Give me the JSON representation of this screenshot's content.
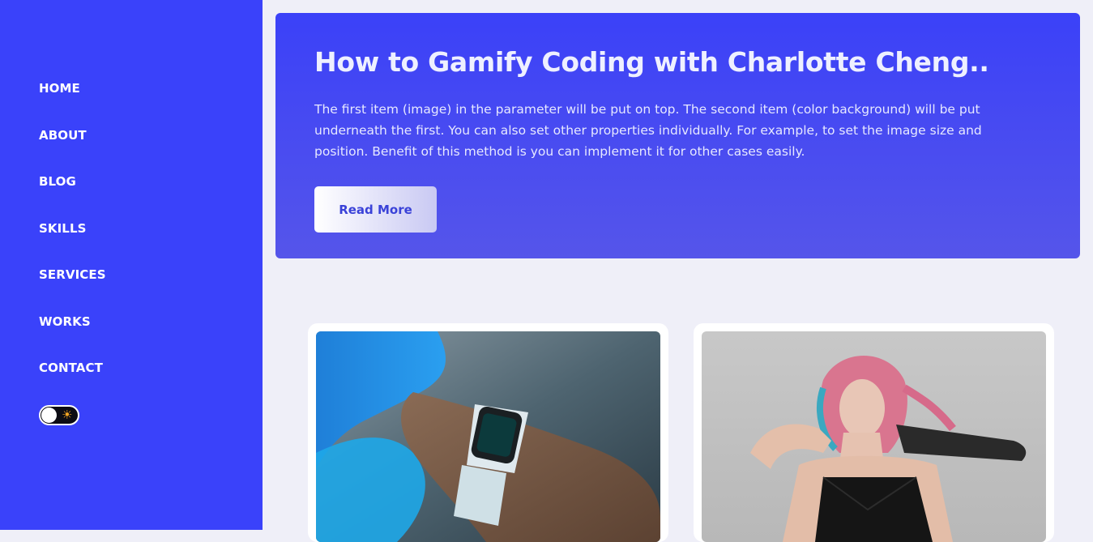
{
  "nav": {
    "items": [
      {
        "label": "HOME"
      },
      {
        "label": "ABOUT"
      },
      {
        "label": "BLOG"
      },
      {
        "label": "SKILLS"
      },
      {
        "label": "SERVICES"
      },
      {
        "label": "WORKS"
      },
      {
        "label": "CONTACT"
      }
    ],
    "theme_icon": "sun-icon"
  },
  "hero": {
    "title": "How to Gamify Coding with Charlotte Cheng..",
    "description": "The first item (image) in the parameter will be put on top. The second item (color background) will be put underneath the first. You can also set other properties individually. For example, to set the image size and position. Benefit of this method is you can implement it for other cases easily.",
    "button_label": "Read More"
  },
  "colors": {
    "sidebar": "#3a42fa",
    "background": "#efeff8",
    "accent_text": "#3a42d8"
  },
  "cards": [
    {
      "image": "smartwatch-photo"
    },
    {
      "image": "woman-prosthetic-arm-photo"
    }
  ]
}
